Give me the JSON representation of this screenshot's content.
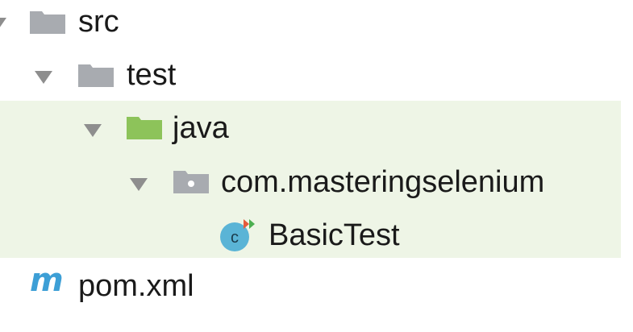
{
  "tree": {
    "nodes": [
      {
        "label": "src",
        "icon": "folder-gray-icon",
        "expanded": true
      },
      {
        "label": "test",
        "icon": "folder-gray-icon",
        "expanded": true
      },
      {
        "label": "java",
        "icon": "folder-green-icon",
        "expanded": true
      },
      {
        "label": "com.masteringselenium",
        "icon": "package-icon",
        "expanded": true
      },
      {
        "label": "BasicTest",
        "icon": "java-class-icon"
      },
      {
        "label": "pom.xml",
        "icon": "maven-icon"
      }
    ],
    "class_icon_letter": "c",
    "maven_icon_letter": "m"
  },
  "colors": {
    "folder_gray": "#a8abb0",
    "folder_green": "#8dc35a",
    "selection_bg": "#eef5e6",
    "class_badge": "#5ab4d6",
    "maven_blue": "#3d9fd6",
    "chevron": "#8e8e8e"
  }
}
